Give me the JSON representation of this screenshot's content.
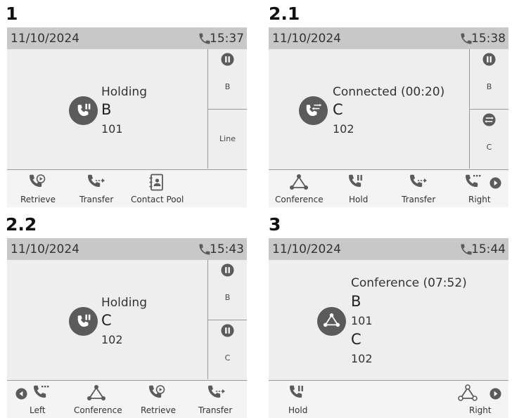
{
  "steps": {
    "s1": "1",
    "s21": "2.1",
    "s22": "2.2",
    "s3": "3"
  },
  "colors": {
    "status_bar": "#c8c8c8",
    "screen_bg": "#eeeeee",
    "icon": "#5b5b5b"
  },
  "screen1": {
    "date": "11/10/2024",
    "time": "15:37",
    "call": {
      "state": "Holding",
      "name": "B",
      "number": "101"
    },
    "lines": [
      {
        "label": "B",
        "icon": "pause-icon"
      },
      {
        "label": "Line"
      }
    ],
    "softkeys": {
      "k1": "Retrieve",
      "k2": "Transfer",
      "k3": "Contact Pool"
    }
  },
  "screen21": {
    "date": "11/10/2024",
    "time": "15:38",
    "call": {
      "state": "Connected (00:20)",
      "name": "C",
      "number": "102"
    },
    "lines": [
      {
        "label": "B",
        "icon": "pause-icon"
      },
      {
        "label": "C",
        "icon": "swap-icon"
      }
    ],
    "softkeys": {
      "k1": "Conference",
      "k2": "Hold",
      "k3": "Transfer",
      "k4": "Right"
    }
  },
  "screen22": {
    "date": "11/10/2024",
    "time": "15:43",
    "call": {
      "state": "Holding",
      "name": "C",
      "number": "102"
    },
    "lines": [
      {
        "label": "B",
        "icon": "pause-icon"
      },
      {
        "label": "C",
        "icon": "pause-icon"
      }
    ],
    "softkeys": {
      "k1": "Left",
      "k2": "Conference",
      "k3": "Retrieve",
      "k4": "Transfer"
    }
  },
  "screen3": {
    "date": "11/10/2024",
    "time": "15:44",
    "call": {
      "state": "Conference (07:52)",
      "name1": "B",
      "number1": "101",
      "name2": "C",
      "number2": "102"
    },
    "softkeys": {
      "k1": "Hold",
      "k2": "Right"
    }
  }
}
